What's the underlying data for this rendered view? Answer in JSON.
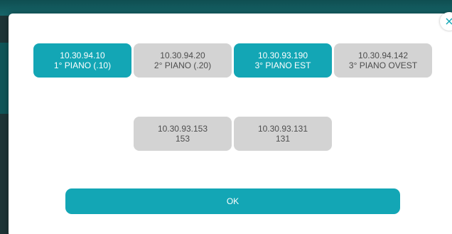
{
  "close_icon": "close-icon",
  "accent_color": "#13a6b5",
  "inactive_color": "#d3d3d3",
  "options": [
    {
      "ip": "10.30.94.10",
      "label": "1° PIANO (.10)",
      "selected": true
    },
    {
      "ip": "10.30.94.20",
      "label": "2° PIANO (.20)",
      "selected": false
    },
    {
      "ip": "10.30.93.190",
      "label": "3° PIANO EST",
      "selected": true
    },
    {
      "ip": "10.30.94.142",
      "label": "3° PIANO OVEST",
      "selected": false
    },
    {
      "ip": "10.30.93.153",
      "label": "153",
      "selected": false
    },
    {
      "ip": "10.30.93.131",
      "label": "131",
      "selected": false
    }
  ],
  "ok_label": "OK"
}
